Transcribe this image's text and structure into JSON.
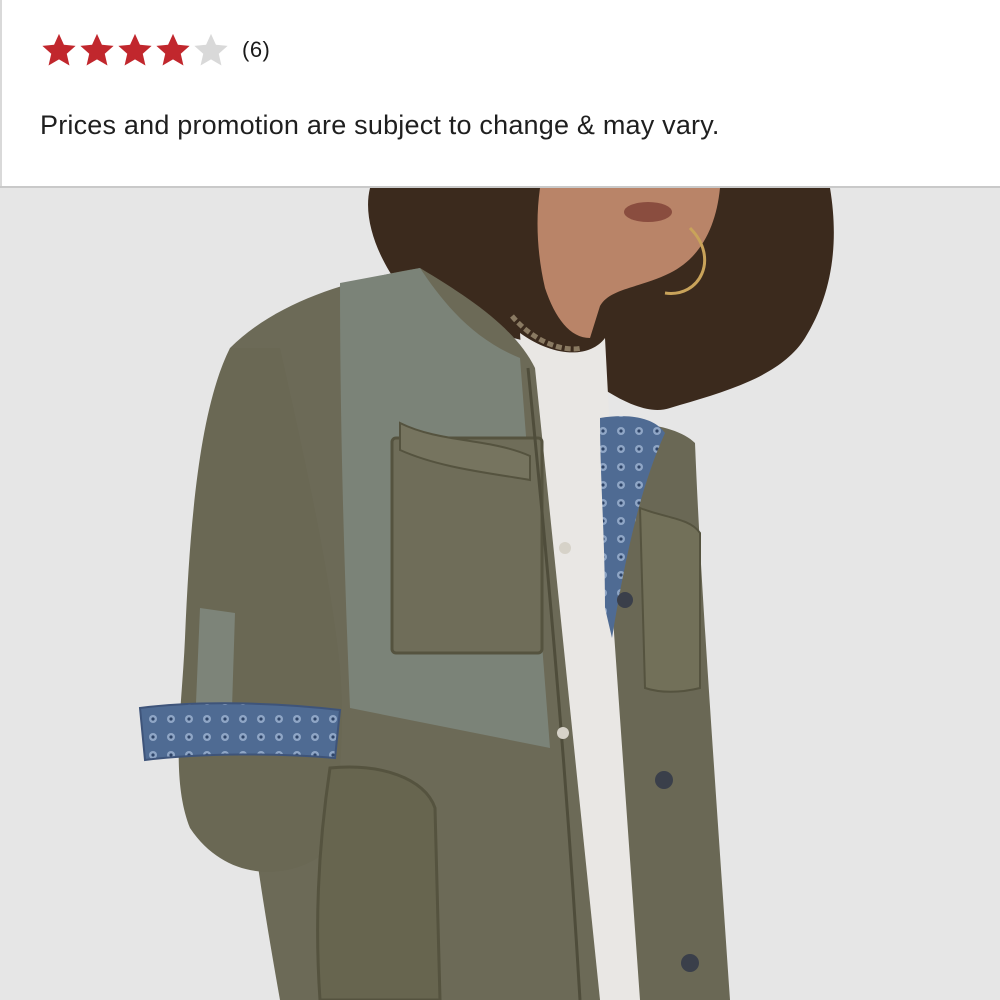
{
  "rating": {
    "value": 4,
    "max": 5,
    "filled_color": "#c1272d",
    "empty_color": "#d9d9d9",
    "count_text": "(6)"
  },
  "disclaimer": "Prices and promotion are subject to change & may vary.",
  "product_image": {
    "description_icon": "product-photo",
    "background_color": "#e6e6e6"
  }
}
